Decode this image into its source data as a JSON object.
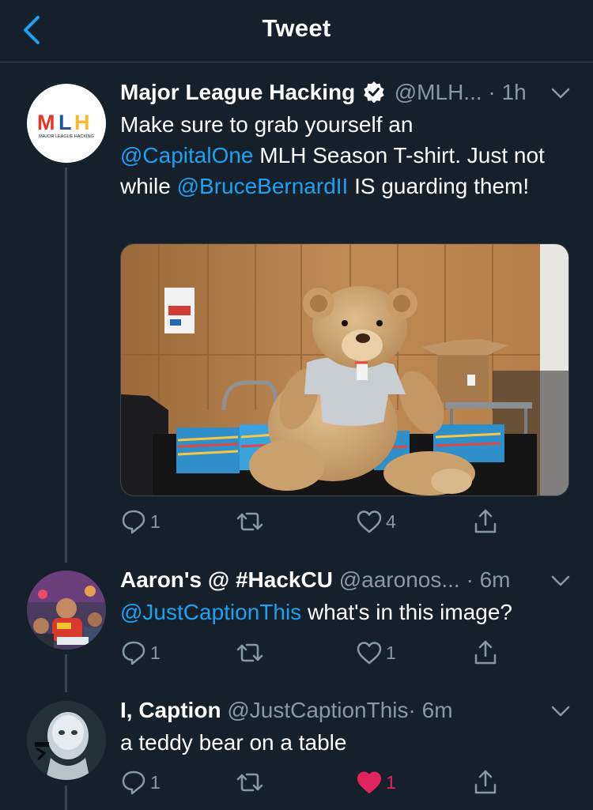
{
  "header": {
    "title": "Tweet"
  },
  "tweets": [
    {
      "name": "Major League Hacking",
      "handle": "@MLH...",
      "time": "· 1h",
      "verified": true,
      "avatar_text": "MLH",
      "avatar_subtext": "MAJOR LEAGUE HACKING",
      "text_parts": [
        "Make sure to grab yourself an",
        "@CapitalOne",
        " MLH Season T-shirt. Just not while ",
        "@BruceBernardII",
        " IS guarding them!"
      ],
      "reply_count": "1",
      "like_count": "4"
    },
    {
      "name": "Aaron's @ #HackCU",
      "handle": "@aaronos...",
      "time": "· 6m",
      "text_parts": [
        "@JustCaptionThis",
        " what's in this image?"
      ],
      "reply_count": "1",
      "like_count": "1"
    },
    {
      "name": "I, Caption",
      "handle": "@JustCaptionThis",
      "time": "· 6m",
      "text": "a teddy bear on a table",
      "reply_count": "1",
      "like_count": "1",
      "liked": true
    }
  ],
  "colors": {
    "background": "#15202b",
    "link": "#1da1f2",
    "muted": "#8899a6",
    "like_active": "#e0245e",
    "divider": "#38444d"
  },
  "icons": [
    "back-chevron-icon",
    "verified-badge-icon",
    "chevron-down-icon",
    "reply-icon",
    "retweet-icon",
    "like-icon",
    "share-icon"
  ]
}
